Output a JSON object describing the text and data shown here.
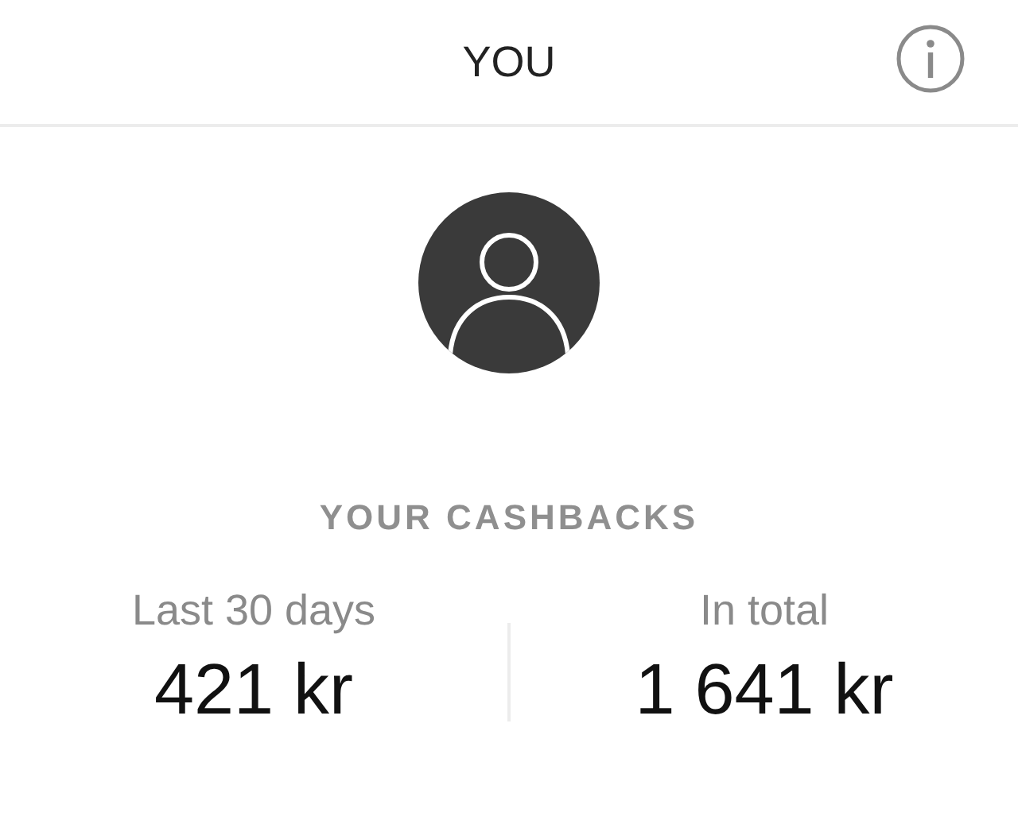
{
  "header": {
    "title": "YOU"
  },
  "section": {
    "title": "YOUR CASHBACKS"
  },
  "stats": [
    {
      "label": "Last 30 days",
      "value": "421 kr"
    },
    {
      "label": "In total",
      "value": "1 641 kr"
    }
  ]
}
